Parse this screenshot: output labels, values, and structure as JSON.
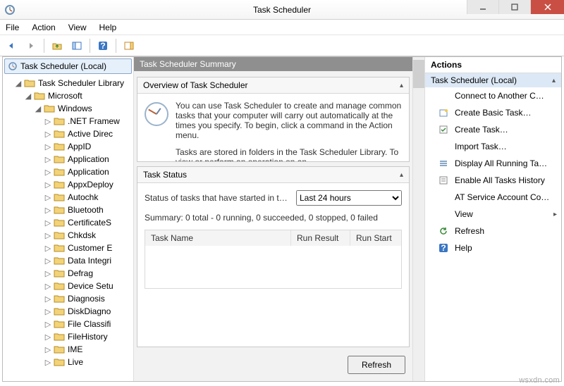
{
  "window": {
    "title": "Task Scheduler"
  },
  "menu": {
    "file": "File",
    "action": "Action",
    "view": "View",
    "help": "Help"
  },
  "tree": {
    "root": "Task Scheduler (Local)",
    "library": "Task Scheduler Library",
    "microsoft": "Microsoft",
    "windows": "Windows",
    "items": [
      ".NET Framew",
      "Active Direc",
      "AppID",
      "Application",
      "Application",
      "AppxDeploy",
      "Autochk",
      "Bluetooth",
      "CertificateS",
      "Chkdsk",
      "Customer E",
      "Data Integri",
      "Defrag",
      "Device Setu",
      "Diagnosis",
      "DiskDiagno",
      "File Classifi",
      "FileHistory",
      "IME",
      "Live"
    ]
  },
  "center": {
    "summary_title": "Task Scheduler Summary",
    "overview_title": "Overview of Task Scheduler",
    "overview_text1": "You can use Task Scheduler to create and manage common tasks that your computer will carry out automatically at the times you specify. To begin, click a command in the Action menu.",
    "overview_text2": "Tasks are stored in folders in the Task Scheduler Library. To view or perform an operation on an",
    "status_title": "Task Status",
    "status_label": "Status of tasks that have started in t…",
    "status_period": "Last 24 hours",
    "status_summary": "Summary: 0 total - 0 running, 0 succeeded, 0 stopped, 0 failed",
    "col_task": "Task Name",
    "col_result": "Run Result",
    "col_start": "Run Start",
    "refresh": "Refresh"
  },
  "actions": {
    "header": "Actions",
    "group": "Task Scheduler (Local)",
    "items": {
      "connect": "Connect to Another C…",
      "create_basic": "Create Basic Task…",
      "create_task": "Create Task…",
      "import": "Import Task…",
      "display_running": "Display All Running Ta…",
      "enable_history": "Enable All Tasks History",
      "at_service": "AT Service Account Co…",
      "view": "View",
      "refresh": "Refresh",
      "help": "Help"
    }
  },
  "watermark": "wsxdn.com"
}
